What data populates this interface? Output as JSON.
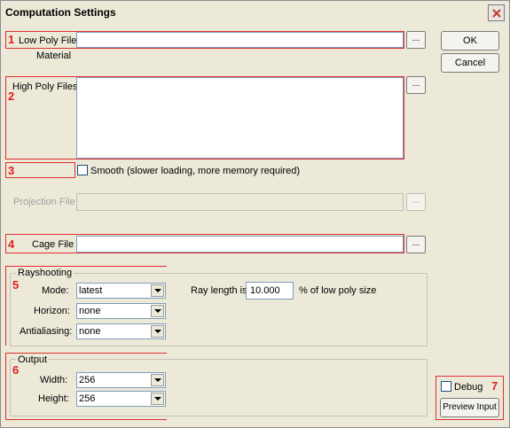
{
  "window": {
    "title": "Computation Settings"
  },
  "annotations": [
    "1",
    "2",
    "3",
    "4",
    "5",
    "6",
    "7"
  ],
  "icons": [
    "close-icon",
    "dropdown-arrow-icon"
  ],
  "low_poly": {
    "label": "Low Poly File",
    "value": "",
    "browse": "...",
    "material_label": "Material"
  },
  "high_poly": {
    "label": "High Poly Files",
    "value": "",
    "browse": "..."
  },
  "smooth": {
    "label": "Smooth (slower loading, more memory required)",
    "checked": false
  },
  "projection": {
    "label": "Projection File",
    "value": "",
    "browse": "...",
    "enabled": false
  },
  "cage": {
    "label": "Cage File",
    "value": "",
    "browse": "..."
  },
  "buttons": {
    "ok": "OK",
    "cancel": "Cancel",
    "preview": "Preview Input"
  },
  "debug": {
    "label": "Debug",
    "checked": false
  },
  "rayshooting": {
    "title": "Rayshooting",
    "mode_label": "Mode:",
    "mode": "latest",
    "horizon_label": "Horizon:",
    "horizon": "none",
    "aa_label": "Antialiasing:",
    "aa": "none",
    "ray_label": "Ray length is",
    "ray_value": "10.000",
    "ray_suffix": "% of low poly size"
  },
  "output": {
    "title": "Output",
    "width_label": "Width:",
    "width": "256",
    "height_label": "Height:",
    "height": "256"
  }
}
